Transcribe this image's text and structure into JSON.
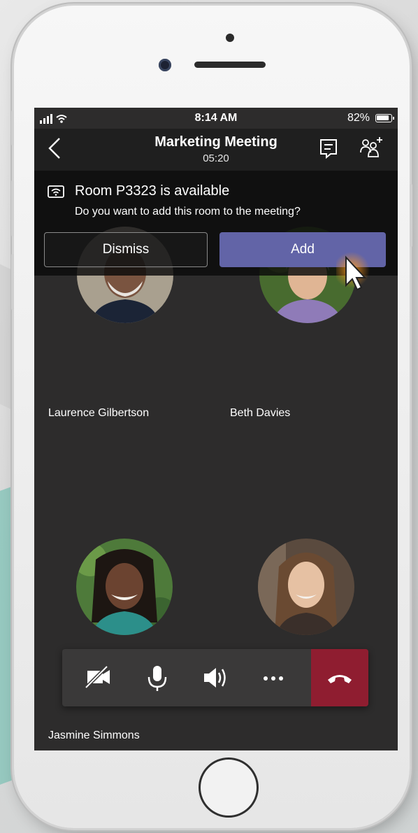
{
  "status_bar": {
    "time": "8:14 AM",
    "battery": "82%"
  },
  "header": {
    "title": "Marketing Meeting",
    "timer": "05:20"
  },
  "banner": {
    "title": "Room P3323 is available",
    "question": "Do you want to add this room to the meeting?",
    "dismiss_label": "Dismiss",
    "add_label": "Add"
  },
  "participants": [
    {
      "name": "Laurence Gilbertson"
    },
    {
      "name": "Beth Davies"
    },
    {
      "name": "Jasmine Simmons"
    },
    {
      "name": ""
    }
  ],
  "controls": [
    "camera-off-icon",
    "microphone-icon",
    "speaker-icon",
    "more-icon",
    "hang-up-icon"
  ],
  "colors": {
    "accent": "#6264a7",
    "hangup": "#8f1d30",
    "stage": "#2d2c2c"
  }
}
